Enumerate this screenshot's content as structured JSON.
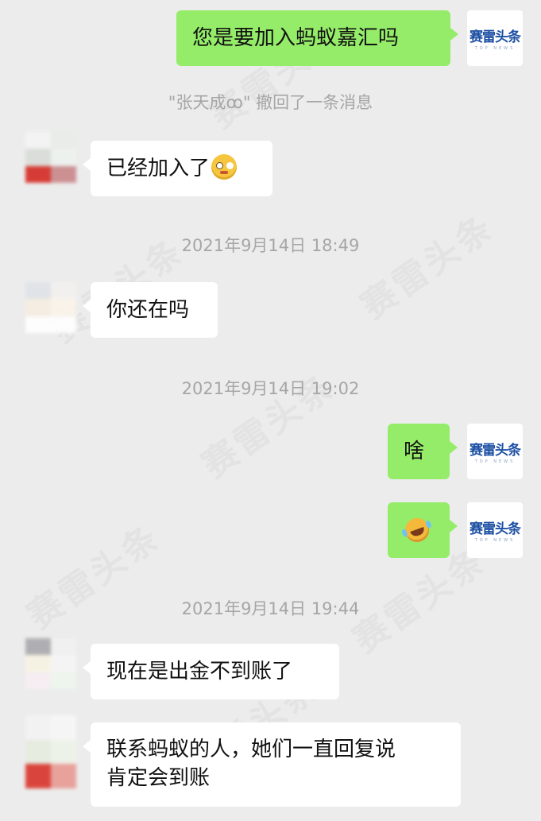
{
  "watermark": "赛雷头条",
  "self_avatar": {
    "name": "赛雷头条",
    "sub": "TOP NEWS"
  },
  "messages": [
    {
      "text": "您是要加入蚂蚁嘉汇吗"
    },
    {
      "text": "\"张天成ꝏ\" 撤回了一条消息"
    },
    {
      "text": "已经加入了"
    },
    {
      "text": "2021年9月14日 18:49"
    },
    {
      "text": "你还在吗"
    },
    {
      "text": "2021年9月14日 19:02"
    },
    {
      "text": "啥"
    },
    {
      "text": ""
    },
    {
      "text": "2021年9月14日 19:44"
    },
    {
      "text": "现在是出金不到账了"
    },
    {
      "text": "联系蚂蚁的人，她们一直回复说"
    },
    {
      "text": "肯定会到账"
    }
  ],
  "emoji": [
    "flushed-face",
    "rolling-laugh-face"
  ]
}
